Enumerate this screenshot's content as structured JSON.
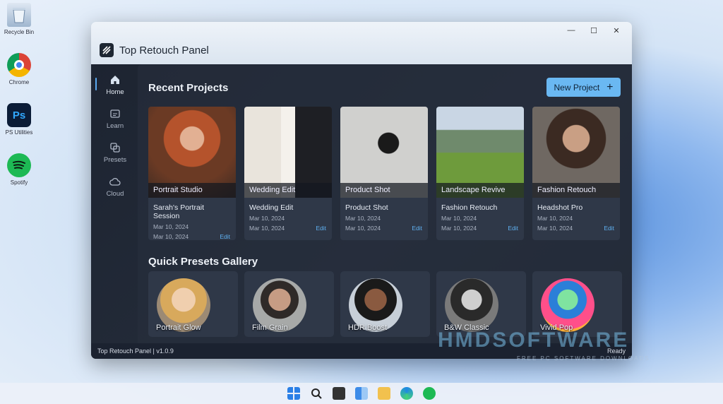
{
  "desktop": {
    "icons": [
      {
        "label": "Recycle Bin",
        "name": "recycle-bin-icon"
      },
      {
        "label": "Chrome",
        "name": "chrome-icon"
      },
      {
        "label": "PS Utilities",
        "name": "photoshop-icon",
        "glyph": "Ps"
      },
      {
        "label": "Spotify",
        "name": "spotify-icon"
      }
    ]
  },
  "window": {
    "title": "Top Retouch Panel",
    "controls": {
      "minimize": "—",
      "maximize": "☐",
      "close": "✕"
    }
  },
  "sidebar": {
    "items": [
      {
        "label": "Home",
        "icon": "home-icon",
        "active": true
      },
      {
        "label": "Learn",
        "icon": "learn-icon",
        "active": false
      },
      {
        "label": "Presets",
        "icon": "presets-icon",
        "active": false
      },
      {
        "label": "Cloud",
        "icon": "cloud-icon",
        "active": false
      }
    ]
  },
  "recent": {
    "title": "Recent Projects",
    "new_button": "New Project",
    "new_button_icon": "+",
    "projects": [
      {
        "caption": "Portrait Studio",
        "name": "Sarah's Portrait Session",
        "date1": "Mar 10, 2024",
        "date2": "Mar 10, 2024",
        "edit": "Edit"
      },
      {
        "caption": "Wedding Edit",
        "name": "Wedding Edit",
        "date1": "Mar 10, 2024",
        "date2": "Mar 10, 2024",
        "edit": "Edit"
      },
      {
        "caption": "Product Shot",
        "name": "Product Shot",
        "date1": "Mar 10, 2024",
        "date2": "Mar 10, 2024",
        "edit": "Edit"
      },
      {
        "caption": "Landscape Revive",
        "name": "Fashion Retouch",
        "date1": "Mar 10, 2024",
        "date2": "Mar 10, 2024",
        "edit": "Edit"
      },
      {
        "caption": "Fashion Retouch",
        "name": "Headshot Pro",
        "date1": "Mar 10, 2024",
        "date2": "Mar 10, 2024",
        "edit": "Edit"
      }
    ]
  },
  "presets": {
    "title": "Quick Presets Gallery",
    "items": [
      {
        "label": "Portrait Glow"
      },
      {
        "label": "Film Grain"
      },
      {
        "label": "HDR Boost"
      },
      {
        "label": "B&W Classic"
      },
      {
        "label": "Vivid Pop"
      }
    ]
  },
  "status": {
    "left": "Top Retouch Panel | v1.0.9",
    "right": "Ready"
  },
  "watermark": {
    "main": "HMDSOFTWARE",
    "sub": "FREE PC SOFTWARE DOWNLOADS"
  },
  "colors": {
    "accent": "#6ab8f2",
    "panel_bg": "#1f2632",
    "card_bg": "#2f3848",
    "link": "#5fb0f0"
  }
}
